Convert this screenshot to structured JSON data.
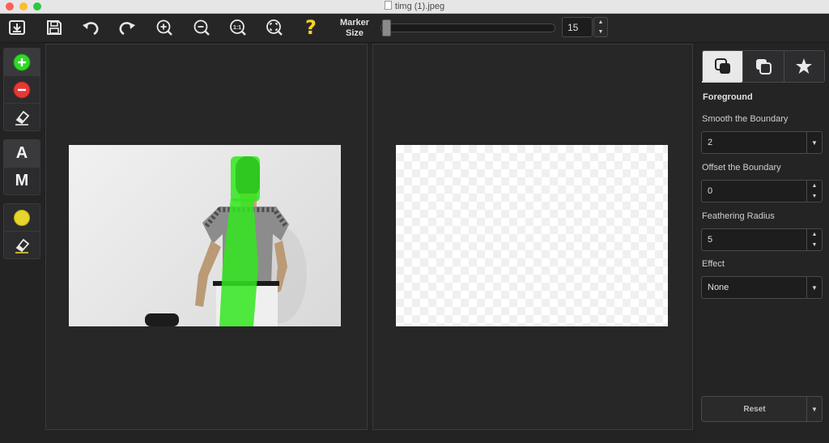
{
  "window": {
    "title": "timg (1).jpeg"
  },
  "toolbar": {
    "buttons": [
      {
        "icon": "save-to-folder-icon"
      },
      {
        "icon": "save-icon"
      },
      {
        "icon": "undo-icon"
      },
      {
        "icon": "redo-icon"
      },
      {
        "icon": "zoom-in-icon"
      },
      {
        "icon": "zoom-out-icon"
      },
      {
        "icon": "actual-size-icon",
        "text": "1:1"
      },
      {
        "icon": "fit-to-window-icon"
      },
      {
        "icon": "help-icon",
        "text": "?"
      }
    ],
    "marker_size_label_line1": "Marker",
    "marker_size_label_line2": "Size",
    "marker_size_value": "15",
    "marker_size_level_fraction": 0.05
  },
  "left_tools": {
    "group1": [
      {
        "icon": "add-foreground-icon"
      },
      {
        "icon": "remove-background-icon"
      },
      {
        "icon": "eraser-icon"
      }
    ],
    "group2": [
      {
        "label": "A"
      },
      {
        "label": "M"
      }
    ],
    "group3": [
      {
        "icon": "color-marker-icon"
      },
      {
        "icon": "eraser-icon"
      }
    ]
  },
  "right_panel": {
    "tabs": [
      {
        "icon": "foreground-tab-icon",
        "active": true
      },
      {
        "icon": "background-tab-icon",
        "active": false
      },
      {
        "icon": "effects-tab-icon",
        "active": false
      }
    ],
    "section_title": "Foreground",
    "smooth_label": "Smooth the Boundary",
    "smooth_value": "2",
    "offset_label": "Offset the Boundary",
    "offset_value": "0",
    "feather_label": "Feathering Radius",
    "feather_value": "5",
    "effect_label": "Effect",
    "effect_value": "None",
    "reset_label": "Reset"
  },
  "colors": {
    "marker_green": "#33e61f",
    "remove_red": "#e53935",
    "help_yellow": "#f5d31a",
    "marker_dot_yellow": "#e6d52a"
  }
}
